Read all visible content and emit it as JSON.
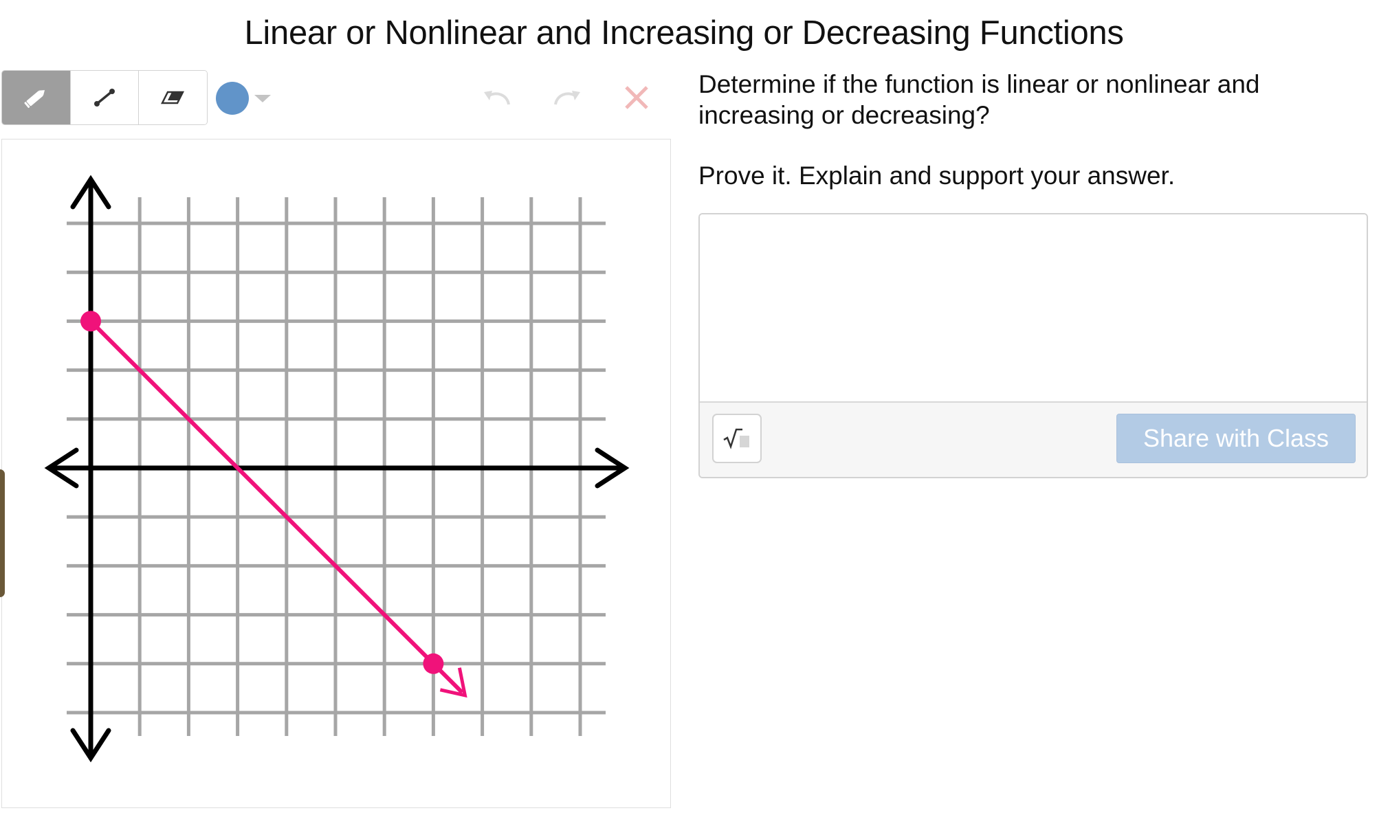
{
  "page": {
    "title": "Linear or Nonlinear and Increasing or Decreasing Functions"
  },
  "toolbar": {
    "tools": [
      {
        "name": "pencil-icon",
        "active": true
      },
      {
        "name": "line-segment-icon",
        "active": false
      },
      {
        "name": "eraser-icon",
        "active": false
      }
    ],
    "color": "#6194c9",
    "undo_icon": "undo-icon",
    "redo_icon": "redo-icon",
    "clear_icon": "close-icon"
  },
  "graph": {
    "line_color": "#f0127a",
    "axis_color": "#000000",
    "grid_color": "#a6a6a6"
  },
  "prompt": {
    "question": "Determine if the function is linear or nonlinear and increasing or decreasing?",
    "instruction": "Prove it.  Explain and support your answer."
  },
  "answer": {
    "value": "",
    "math_button_icon": "square-root-icon",
    "share_label": "Share with Class"
  }
}
